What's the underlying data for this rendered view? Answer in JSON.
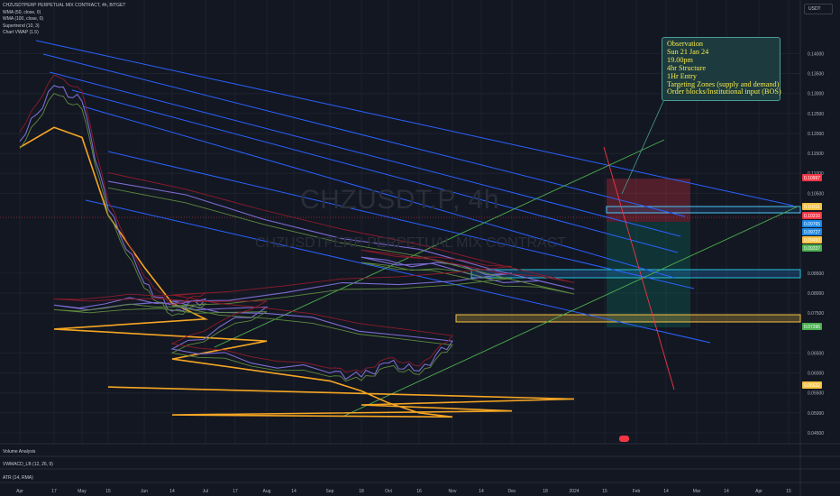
{
  "header": {
    "symbol_title": "CHZUSDTPERP PERPETUAL MIX CONTRACT, 4h, BITGET",
    "indicators": [
      "WMA (50, close, 0)",
      "WMA (100, close, 0)",
      "Supertrend (10, 3)",
      "Chart VWAP (1.5)"
    ],
    "currency_button": "USDT"
  },
  "watermark": {
    "main": "CHZUSDT.P, 4h",
    "sub": "CHZUSDTPERP PERPETUAL MIX CONTRACT"
  },
  "observation": {
    "lines": [
      "Observation",
      "Sun 21 Jan 24",
      "19.00pm",
      "4hr Structure",
      "1Hr Entry",
      "Targeting Zones (supply and demand)",
      "Order blocks/Institutional input (BOS)"
    ]
  },
  "panes": [
    "Volume Analysis",
    "VWMACD_LB (12, 26, 9)",
    "ATR (14, RMA)"
  ],
  "chart_data": {
    "type": "line",
    "title": "CHZUSDT.P, 4h",
    "ylim": [
      0.045,
      0.148
    ],
    "y_ticks": [
      "0.14000",
      "0.13500",
      "0.13000",
      "0.12500",
      "0.12000",
      "0.11500",
      "0.11000",
      "0.10500",
      "0.08500",
      "0.08000",
      "0.07500",
      "0.06500",
      "0.06000",
      "0.05500",
      "0.05000",
      "0.04500"
    ],
    "x_ticks": [
      "Apr",
      "17",
      "May",
      "15",
      "Jun",
      "14",
      "Jul",
      "17",
      "Aug",
      "14",
      "Sep",
      "18",
      "Oct",
      "16",
      "Nov",
      "14",
      "Dec",
      "18",
      "2024",
      "15",
      "Feb",
      "14",
      "Mar",
      "14",
      "Apr",
      "15"
    ],
    "price_badges": [
      {
        "label": "0.10997",
        "color": "#f23645"
      },
      {
        "label": "0.10311",
        "color": "#f5c242"
      },
      {
        "label": "0.10210",
        "color": "#f23645"
      },
      {
        "label": "0.09765",
        "color": "#1e88e5"
      },
      {
        "label": "0.09727",
        "color": "#1e88e5"
      },
      {
        "label": "0.09450",
        "color": "#f5c242"
      },
      {
        "label": "0.09337",
        "color": "#4caf50"
      },
      {
        "label": "0.07295",
        "color": "#4caf50"
      },
      {
        "label": "0.05632",
        "color": "#f5c242"
      }
    ],
    "series": [
      {
        "name": "Chart VWAP",
        "color": "#f5a623",
        "x": [
          "Apr",
          "17",
          "May",
          "15",
          "Jun",
          "14",
          "Jul",
          "17",
          "Aug",
          "14",
          "Sep",
          "18",
          "Oct",
          "16",
          "Nov",
          "14",
          "Dec",
          "18",
          "2024",
          "15"
        ],
        "values": [
          0.1165,
          0.1215,
          0.119,
          0.0995,
          0.0865,
          0.0775,
          0.0735,
          0.071,
          0.068,
          0.0635,
          0.058,
          0.0555,
          0.0525,
          0.05,
          0.049,
          0.0495,
          0.0505,
          0.052,
          0.0535,
          0.0565
        ]
      },
      {
        "name": "Price",
        "color": "#7b6cd1",
        "x": [
          "Apr",
          "17",
          "May",
          "15",
          "Jun",
          "14",
          "Jul",
          "17",
          "Aug",
          "14",
          "Sep",
          "18",
          "Oct",
          "16",
          "Nov",
          "14",
          "Dec",
          "18",
          "2024",
          "15"
        ],
        "values": [
          0.118,
          0.132,
          0.128,
          0.101,
          0.0825,
          0.0755,
          0.0785,
          0.077,
          0.0765,
          0.066,
          0.06,
          0.059,
          0.0625,
          0.0605,
          0.068,
          0.078,
          0.085,
          0.089,
          0.081,
          0.108
        ]
      }
    ]
  }
}
